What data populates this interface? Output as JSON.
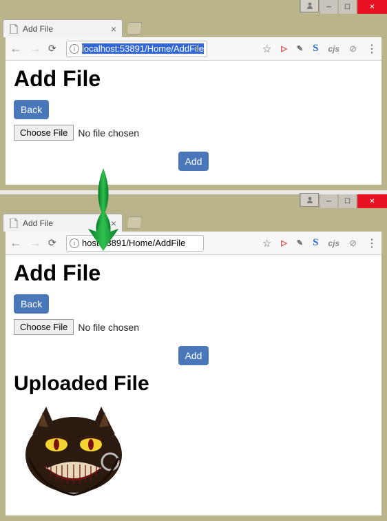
{
  "window1": {
    "tab_title": "Add File",
    "url_host": "localhost:53891",
    "url_path": "/Home/AddFile",
    "heading": "Add File",
    "back_label": "Back",
    "choose_label": "Choose File",
    "file_status": "No file chosen",
    "add_label": "Add",
    "ext_cjs": "cjs",
    "ext_s": "S"
  },
  "window2": {
    "tab_title": "Add File",
    "url_full": "host:53891/Home/AddFile",
    "heading": "Add File",
    "back_label": "Back",
    "choose_label": "Choose File",
    "file_status": "No file chosen",
    "add_label": "Add",
    "uploaded_heading": "Uploaded File",
    "ext_cjs": "cjs",
    "ext_s": "S"
  }
}
